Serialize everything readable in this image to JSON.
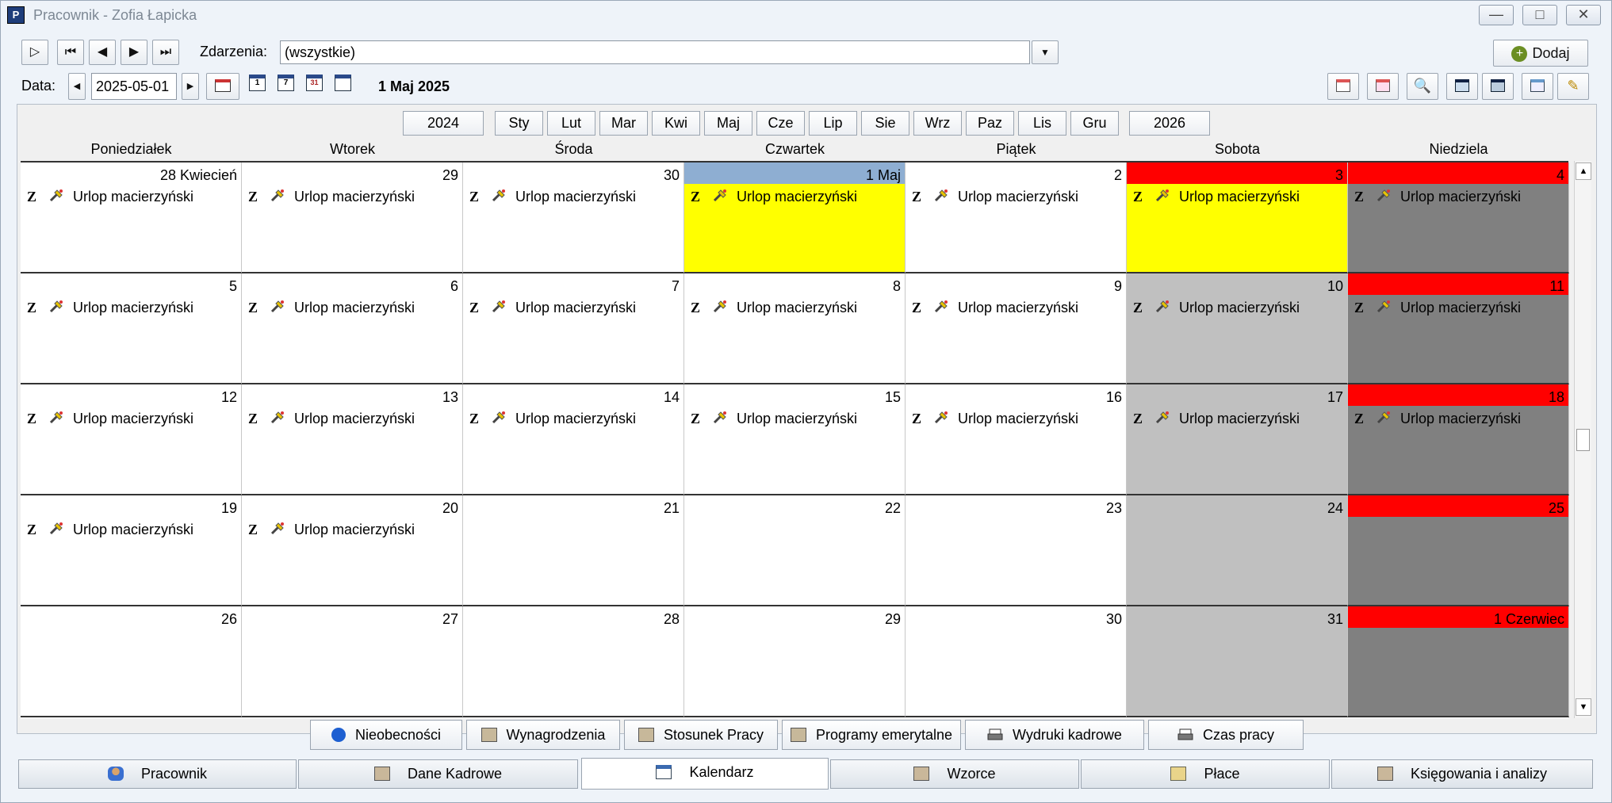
{
  "window": {
    "title": "Pracownik - Zofia Łapicka",
    "app_icon": "app-icon"
  },
  "toolbar": {
    "events_label": "Zdarzenia:",
    "events_value": "(wszystkie)",
    "add_label": "Dodaj",
    "date_label": "Data:",
    "date_value": "2025-05-01",
    "current_date": "1 Maj 2025"
  },
  "months": {
    "prev_year": "2024",
    "next_year": "2026",
    "items": [
      "Sty",
      "Lut",
      "Mar",
      "Kwi",
      "Maj",
      "Cze",
      "Lip",
      "Sie",
      "Wrz",
      "Paz",
      "Lis",
      "Gru"
    ]
  },
  "day_names": [
    "Poniedziałek",
    "Wtorek",
    "Środa",
    "Czwartek",
    "Piątek",
    "Sobota",
    "Niedziela"
  ],
  "event_code": "Z",
  "event_label": "Urlop macierzyński",
  "weeks": [
    [
      "28 Kwiecień",
      "29",
      "30",
      "1 Maj",
      "2",
      "3",
      "4"
    ],
    [
      "5",
      "6",
      "7",
      "8",
      "9",
      "10",
      "11"
    ],
    [
      "12",
      "13",
      "14",
      "15",
      "16",
      "17",
      "18"
    ],
    [
      "19",
      "20",
      "21",
      "22",
      "23",
      "24",
      "25"
    ],
    [
      "26",
      "27",
      "28",
      "29",
      "30",
      "31",
      "1 Czerwiec"
    ]
  ],
  "events_by_week": [
    7,
    7,
    7,
    2,
    0
  ],
  "subtabs": [
    "Nieobecności",
    "Wynagrodzenia",
    "Stosunek Pracy",
    "Programy emerytalne",
    "Wydruki kadrowe",
    "Czas pracy"
  ],
  "main_tabs": [
    "Pracownik",
    "Dane Kadrowe",
    "Kalendarz",
    "Wzorce",
    "Płace",
    "Księgowania i analizy"
  ],
  "active_main_tab": "Kalendarz",
  "colors": {
    "today": "#8eaed2",
    "weekend_sat": "#c0c0c0",
    "weekend_sun": "#808080",
    "holiday": "#ff0000",
    "event_highlight": "#ffff00"
  }
}
